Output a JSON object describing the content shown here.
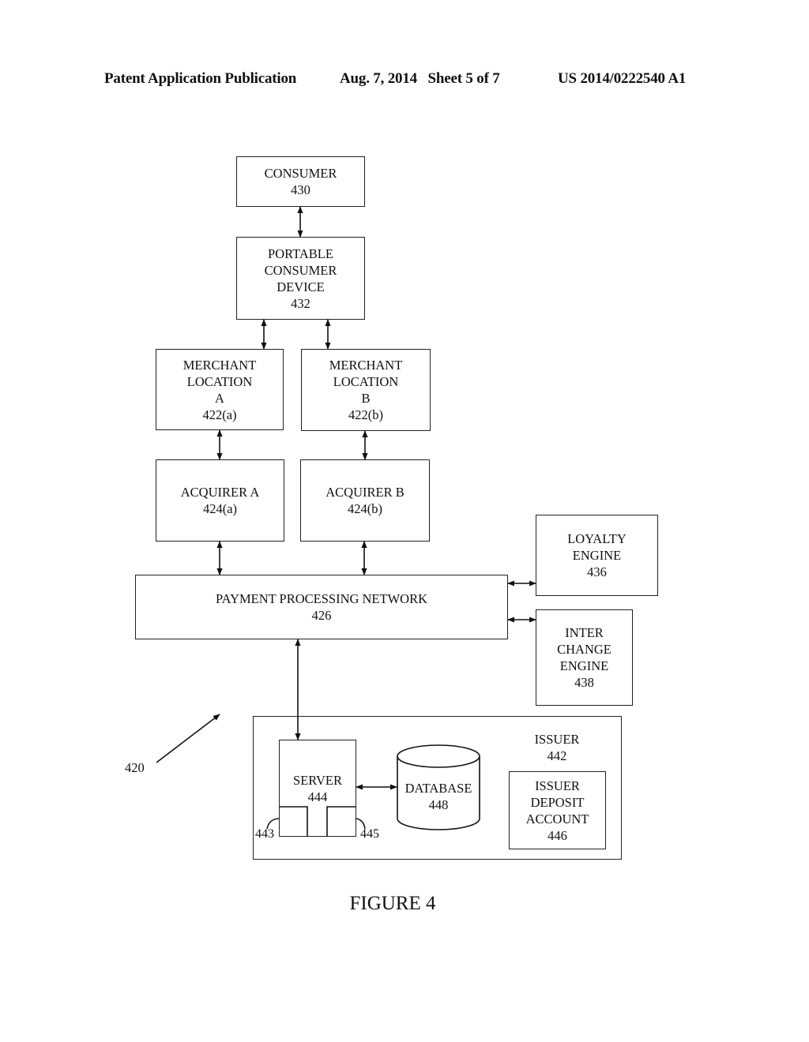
{
  "header": {
    "left": "Patent Application Publication",
    "date_sheet": "Aug. 7, 2014   Sheet 5 of 7",
    "number": "US 2014/0222540 A1"
  },
  "diagram": {
    "system_ref": "420",
    "nodes": {
      "consumer": {
        "name": "CONSUMER",
        "ref": "430"
      },
      "portable_device": {
        "line1": "PORTABLE",
        "line2": "CONSUMER",
        "line3": "DEVICE",
        "ref": "432"
      },
      "merchant_a": {
        "line1": "MERCHANT",
        "line2": "LOCATION",
        "line3": "A",
        "ref": "422(a)"
      },
      "merchant_b": {
        "line1": "MERCHANT",
        "line2": "LOCATION",
        "line3": "B",
        "ref": "422(b)"
      },
      "acquirer_a": {
        "name": "ACQUIRER A",
        "ref": "424(a)"
      },
      "acquirer_b": {
        "name": "ACQUIRER B",
        "ref": "424(b)"
      },
      "payment_network": {
        "name": "PAYMENT PROCESSING NETWORK",
        "ref": "426"
      },
      "loyalty_engine": {
        "line1": "LOYALTY",
        "line2": "ENGINE",
        "ref": "436"
      },
      "interchange_engine": {
        "line1": "INTER",
        "line2": "CHANGE",
        "line3": "ENGINE",
        "ref": "438"
      },
      "issuer": {
        "name": "ISSUER",
        "ref": "442"
      },
      "server": {
        "name": "SERVER",
        "ref": "444",
        "sub_left_ref": "443",
        "sub_right_ref": "445"
      },
      "database": {
        "name": "DATABASE",
        "ref": "448"
      },
      "deposit_account": {
        "line1": "ISSUER",
        "line2": "DEPOSIT",
        "line3": "ACCOUNT",
        "ref": "446"
      }
    },
    "figure_label": "FIGURE 4"
  }
}
